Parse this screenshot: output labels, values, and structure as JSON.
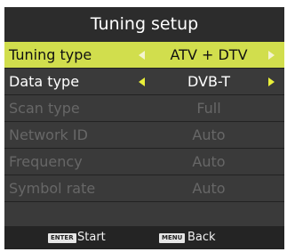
{
  "title": "Tuning setup",
  "rows": [
    {
      "label": "Tuning type",
      "value": "ATV + DTV"
    },
    {
      "label": "Data type",
      "value": "DVB-T"
    },
    {
      "label": "Scan type",
      "value": "Full"
    },
    {
      "label": "Network ID",
      "value": "Auto"
    },
    {
      "label": "Frequency",
      "value": "Auto"
    },
    {
      "label": "Symbol rate",
      "value": "Auto"
    }
  ],
  "footer": {
    "enter_key": "ENTER",
    "enter_label": "Start",
    "menu_key": "MENU",
    "menu_label": "Back"
  },
  "colors": {
    "highlight_row": "#d1de4d",
    "arrow_active": "#e9ef3a",
    "disabled_text": "#676767"
  }
}
